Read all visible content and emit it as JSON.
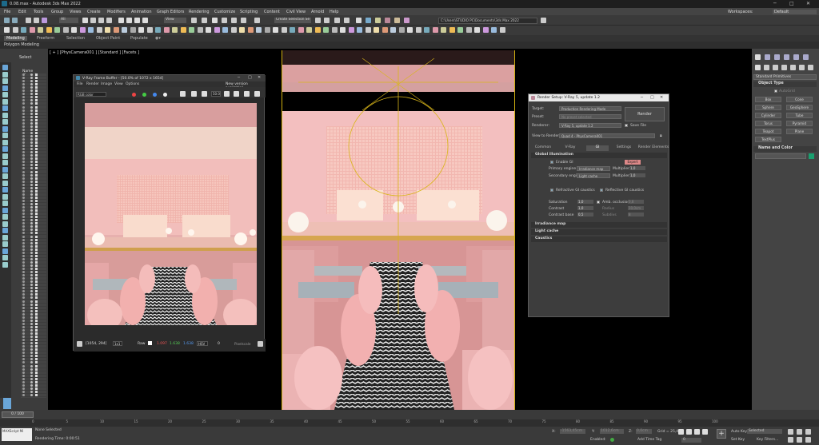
{
  "window": {
    "title": "0.08.max - Autodesk 3ds Max 2022",
    "workspace_label": "Workspaces:",
    "workspace_value": "Default"
  },
  "menu": [
    "File",
    "Edit",
    "Tools",
    "Group",
    "Views",
    "Create",
    "Modifiers",
    "Animation",
    "Graph Editors",
    "Rendering",
    "Customize",
    "Scripting",
    "Content",
    "Civil View",
    "Arnold",
    "Help"
  ],
  "toolbar": {
    "filter": "All",
    "view": "View",
    "selection_set": "Create Selection Se",
    "project_path": "C:\\Users\\STUDIO PC\\Documents\\3ds Max 2022"
  },
  "ribbon": {
    "tabs": [
      "Modeling",
      "Freeform",
      "Selection",
      "Object Paint",
      "Populate"
    ],
    "active": "Polygon Modeling"
  },
  "left": {
    "select_label": "Select",
    "header": "Name (Sorted..."
  },
  "viewport": {
    "label": "[ + ] [PhysCamera001 ] [Standard ] [Facets ]"
  },
  "frame_buffer": {
    "title": "V-Ray Frame Buffer - [50.0% of 1072 x 1654]",
    "menu": [
      "File",
      "Render",
      "Image",
      "View",
      "Options"
    ],
    "notice": "New version available!",
    "channel": "RGB color",
    "zoom": "50.0",
    "coords": "[1054, 294]",
    "mode": "1x1",
    "raw": "Raw",
    "r": "1.097",
    "g": "1.638",
    "b": "1.638",
    "hsv": "HSV",
    "val": "0",
    "pixel": "Pixelscale"
  },
  "render_setup": {
    "title": "Render Setup: V-Ray 5, update 1.2",
    "target_label": "Target:",
    "target": "Production Rendering Mode",
    "preset_label": "Preset:",
    "preset": "No preset selected",
    "renderer_label": "Renderer:",
    "renderer": "V-Ray 5, update 1.2",
    "save_file": "Save File",
    "view_label": "View to Render:",
    "view": "Quad 4 - PhysCamera001",
    "render_button": "Render",
    "tabs": [
      "Common",
      "V-Ray",
      "GI",
      "Settings",
      "Render Elements"
    ],
    "gi_section": "Global illumination",
    "enable_gi": "Enable GI",
    "expert": "Expert",
    "primary_label": "Primary engine",
    "primary": "Irradiance map",
    "secondary_label": "Secondary engine",
    "secondary": "Light cache",
    "multiplier_label": "Multiplier",
    "mult1": "1,0",
    "mult2": "1,0",
    "refractive": "Refractive GI caustics",
    "reflective": "Reflective GI caustics",
    "saturation_label": "Saturation",
    "saturation": "1,0",
    "contrast_label": "Contrast",
    "contrast": "1,0",
    "contrast_base_label": "Contrast base",
    "contrast_base": "0,5",
    "ao_label": "Amb. occlusion",
    "ao": "0,8",
    "radius_label": "Radius",
    "radius": "10,0cm",
    "subdivs_label": "Subdivs",
    "subdivs": "8",
    "sections": [
      "Irradiance map",
      "Light cache",
      "Caustics"
    ]
  },
  "right_panel": {
    "dropdown": "Standard Primitives",
    "object_type": "Object Type",
    "autogrid": "AutoGrid",
    "buttons": [
      "Box",
      "Cone",
      "Sphere",
      "GeoSphere",
      "Cylinder",
      "Tube",
      "Torus",
      "Pyramid",
      "Teapot",
      "Plane",
      "TextPlus"
    ],
    "name_color": "Name and Color",
    "accent": "#1aa070"
  },
  "timeline": {
    "frame": "0 / 100",
    "ticks": [
      "0",
      "5",
      "10",
      "15",
      "20",
      "25",
      "30",
      "35",
      "40",
      "45",
      "50",
      "55",
      "60",
      "65",
      "70",
      "75",
      "80",
      "85",
      "90",
      "95",
      "100"
    ]
  },
  "status": {
    "script": "MAXScript Mi",
    "none_selected": "None Selected",
    "render_time": "Rendering Time: 0:00:51",
    "x_label": "X:",
    "x": "-1563,45cm",
    "y_label": "Y:",
    "y": "1012,6cm",
    "z_label": "Z:",
    "z": "0,0cm",
    "grid": "Grid = 25,4cm",
    "enabled": "Enabled:",
    "add_time_tag": "Add Time Tag",
    "auto_key": "Auto Key",
    "selected": "Selected",
    "set_key": "Set Key",
    "key_filters": "Key Filters...",
    "frame_field": "0"
  }
}
